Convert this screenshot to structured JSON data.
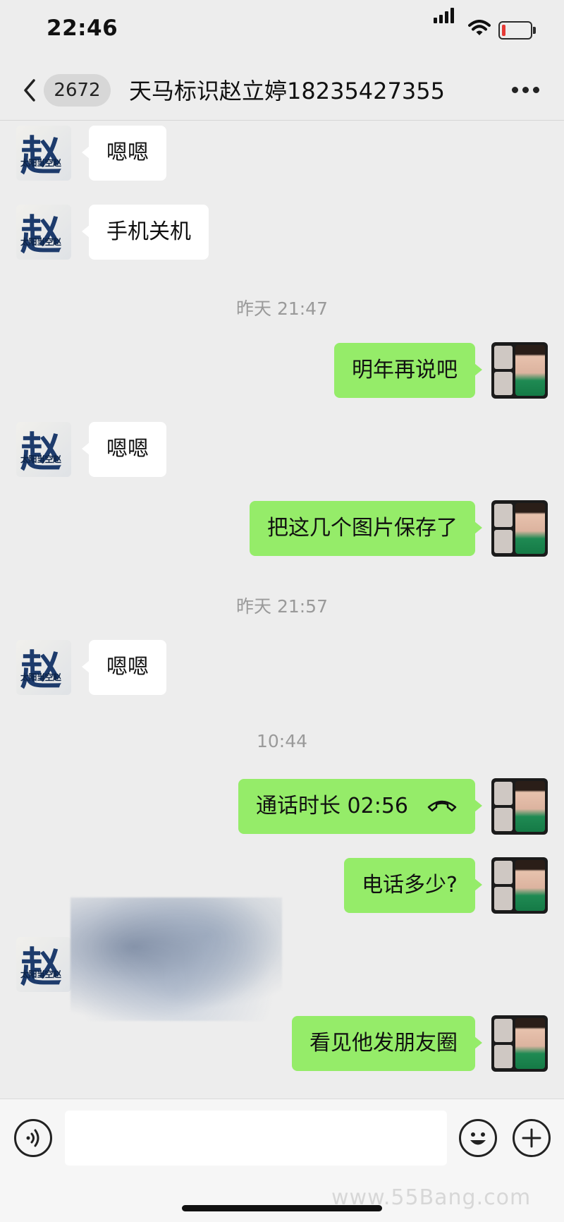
{
  "status_bar": {
    "time": "22:46",
    "battery_level": 0.15,
    "battery_color": "#e53935"
  },
  "nav": {
    "back_icon": "chevron-left-icon",
    "unread_count": "2672",
    "title": "天马标识赵立婷18235427355",
    "more_icon": "more-dots-icon"
  },
  "chat": {
    "contact_avatar_text": {
      "big": "赵",
      "small": "太阳当空赵"
    },
    "messages": [
      {
        "side": "left",
        "text": "嗯嗯"
      },
      {
        "side": "left",
        "text": "手机关机"
      },
      {
        "type": "timestamp",
        "text": "昨天 21:47"
      },
      {
        "side": "right",
        "text": "明年再说吧"
      },
      {
        "side": "left",
        "text": "嗯嗯"
      },
      {
        "side": "right",
        "text": "把这几个图片保存了"
      },
      {
        "type": "timestamp",
        "text": "昨天 21:57"
      },
      {
        "side": "left",
        "text": "嗯嗯"
      },
      {
        "type": "timestamp",
        "text": "10:44"
      },
      {
        "side": "right",
        "text": "通话时长 02:56",
        "icon": "phone-hangup-icon"
      },
      {
        "side": "right",
        "text": "电话多少?"
      },
      {
        "side": "left",
        "type": "redacted"
      },
      {
        "side": "right",
        "text": "看见他发朋友圈"
      }
    ]
  },
  "input_bar": {
    "voice_icon": "voice-icon",
    "emoji_icon": "emoji-icon",
    "plus_icon": "plus-icon",
    "text_value": ""
  },
  "watermark": "www.55Bang.com",
  "colors": {
    "background": "#ededed",
    "my_bubble": "#95ec69",
    "their_bubble": "#ffffff"
  }
}
